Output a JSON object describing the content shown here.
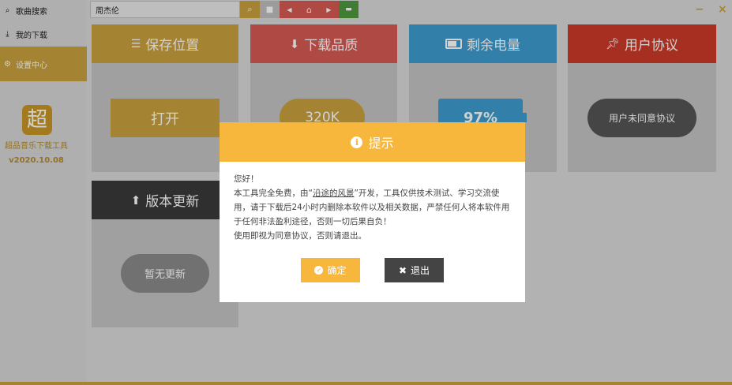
{
  "sidebar": {
    "items": [
      {
        "label": "歌曲搜索",
        "icon": "search-icon"
      },
      {
        "label": "我的下载",
        "icon": "download-icon"
      },
      {
        "label": "设置中心",
        "icon": "gear-icon"
      }
    ],
    "logo_text": "超",
    "app_name": "超品音乐下载工具",
    "version": "v2020.10.08"
  },
  "search": {
    "value": "周杰伦"
  },
  "toolbar": {
    "buttons": [
      {
        "icon": "search-icon",
        "glyph": "⌕"
      },
      {
        "icon": "trash-icon",
        "glyph": "🗑"
      },
      {
        "icon": "prev-icon",
        "glyph": "◀"
      },
      {
        "icon": "home-icon",
        "glyph": "⌂"
      },
      {
        "icon": "next-icon",
        "glyph": "▶"
      },
      {
        "icon": "folder-icon",
        "glyph": "▬"
      }
    ]
  },
  "window": {
    "minimize": "−",
    "close": "×"
  },
  "cards": {
    "save_location": {
      "title": "保存位置",
      "button": "打开",
      "color": "#c8a23e"
    },
    "quality": {
      "title": "下载品质",
      "button": "320K",
      "color": "#d65a54"
    },
    "battery": {
      "title": "剩余电量",
      "value": "97%",
      "color": "#3d9bcf"
    },
    "agreement": {
      "title": "用户协议",
      "button": "用户未同意协议",
      "color": "#cc3a2a"
    },
    "update": {
      "title": "版本更新",
      "button": "暂无更新",
      "color": "#3a3a3a"
    }
  },
  "dialog": {
    "title": "提示",
    "greeting": "您好！",
    "line1_a": "本工具完全免费，由“",
    "line1_author": "沿途的风景",
    "line1_b": "”开发，工具仅供技术测试、学习交流使用，请于下载后24小时内删除本软件以及相关数据，严禁任何人将本软件用于任何非法盈利途径，否则一切后果自负！",
    "line2": "使用即视为同意协议，否则请退出。",
    "confirm": "确定",
    "exit": "退出",
    "confirm_color": "#f6b73c",
    "exit_color": "#444444"
  }
}
